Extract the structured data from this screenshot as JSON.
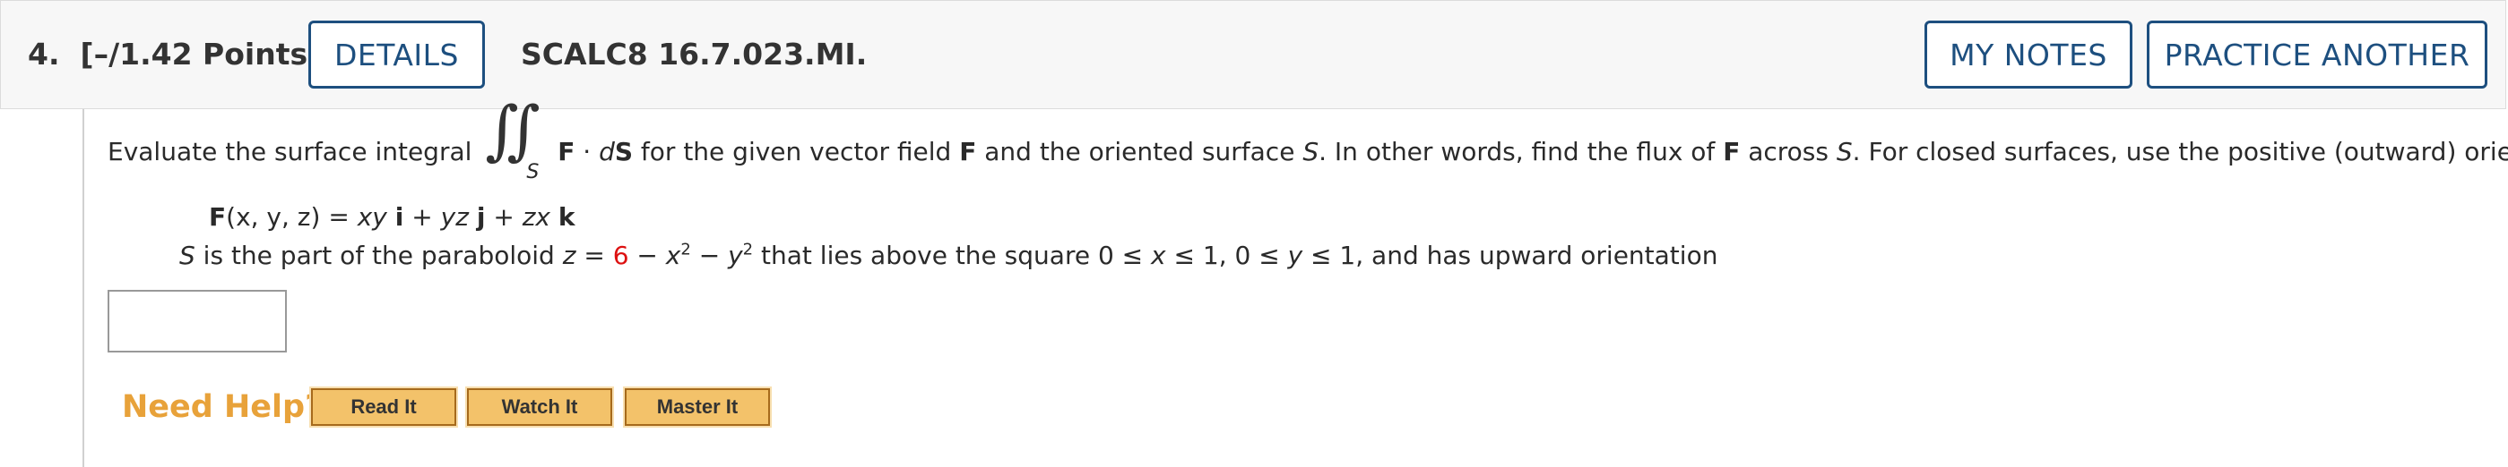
{
  "header": {
    "question_number": "4.",
    "points": "[–/1.42 Points]",
    "details_label": "DETAILS",
    "code": "SCALC8 16.7.023.MI.",
    "my_notes_label": "MY NOTES",
    "practice_label": "PRACTICE ANOTHER"
  },
  "question": {
    "intro": "Evaluate the surface integral",
    "integral_sub": "S",
    "integrand_F": "F",
    "integrand_dot": " · ",
    "integrand_d": "d",
    "integrand_S": "S",
    "text_a": "  for the given vector field ",
    "text_F1": "F",
    "text_b": " and the oriented surface ",
    "text_S1": "S",
    "text_c": ". In other words, find the flux of ",
    "text_F2": "F",
    "text_d": " across ",
    "text_S2": "S",
    "text_e": ". For closed surfaces, use the positive (outward) orientation.",
    "field_F": "F",
    "field_args": "(x, y, z)",
    "field_eq": " = ",
    "field_t1": "xy",
    "field_i": "i",
    "field_plus1": " + ",
    "field_t2": "yz",
    "field_j": "j",
    "field_plus2": " + ",
    "field_t3": "zx",
    "field_k": "k",
    "surf_S": "S",
    "surf_a": " is the part of the paraboloid  ",
    "surf_z": "z",
    "surf_eq": " = ",
    "surf_6": "6",
    "surf_minus1": " − ",
    "surf_x": "x",
    "surf_exp1": "2",
    "surf_minus2": " − ",
    "surf_y": "y",
    "surf_exp2": "2",
    "surf_b": " that lies above the square 0 ≤ ",
    "surf_x2": "x",
    "surf_c": " ≤ 1, 0 ≤ ",
    "surf_y2": "y",
    "surf_d": " ≤ 1,  and has upward orientation"
  },
  "answer": {
    "value": ""
  },
  "help": {
    "title": "Need Help?",
    "read_it": "Read It",
    "watch_it": "Watch It",
    "master_it": "Master It"
  }
}
